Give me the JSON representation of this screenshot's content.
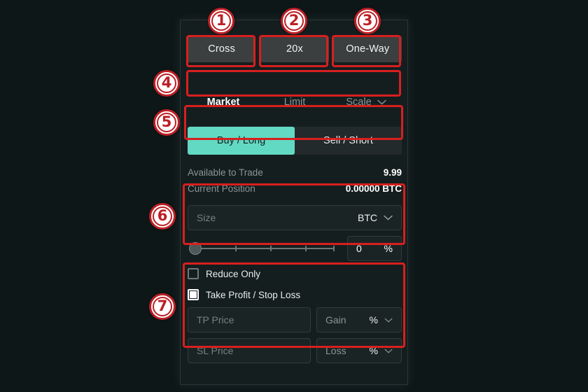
{
  "panel": {
    "margin_buttons": [
      {
        "label": "Cross",
        "name": "margin-mode-button"
      },
      {
        "label": "20x",
        "name": "leverage-button"
      },
      {
        "label": "One-Way",
        "name": "position-mode-button"
      }
    ],
    "order_types": [
      {
        "label": "Market",
        "active": true
      },
      {
        "label": "Limit",
        "active": false
      },
      {
        "label": "Scale",
        "active": false
      }
    ],
    "sides": [
      {
        "label": "Buy / Long",
        "active": true
      },
      {
        "label": "Sell / Short",
        "active": false
      }
    ],
    "info": [
      {
        "label": "Available to Trade",
        "value": "9.99"
      },
      {
        "label": "Current Position",
        "value": "0.00000 BTC"
      }
    ],
    "size": {
      "placeholder": "Size",
      "unit": "BTC"
    },
    "slider": {
      "percent_value": "0",
      "percent_symbol": "%",
      "position": 0,
      "ticks": [
        25,
        50,
        75,
        100
      ]
    },
    "reduce_only": {
      "label": "Reduce Only",
      "checked": false
    },
    "tpsl": {
      "label": "Take Profit / Stop Loss",
      "checked": true,
      "tp_price_placeholder": "TP Price",
      "tp_mode_label": "Gain",
      "tp_mode_unit": "%",
      "sl_price_placeholder": "SL Price",
      "sl_mode_label": "Loss",
      "sl_mode_unit": "%"
    }
  },
  "markers": [
    {
      "num": "①",
      "label": "1"
    },
    {
      "num": "②",
      "label": "2"
    },
    {
      "num": "③",
      "label": "3"
    },
    {
      "num": "④",
      "label": "4"
    },
    {
      "num": "⑤",
      "label": "5"
    },
    {
      "num": "⑥",
      "label": "6"
    },
    {
      "num": "⑦",
      "label": "7"
    }
  ],
  "colors": {
    "background": "#0e1718",
    "panel": "#151e1f",
    "annotation_red": "#d81f1f",
    "marker_red": "#bc1f25",
    "buy_teal": "#62d9c3",
    "button_gray": "#3b3f40"
  }
}
